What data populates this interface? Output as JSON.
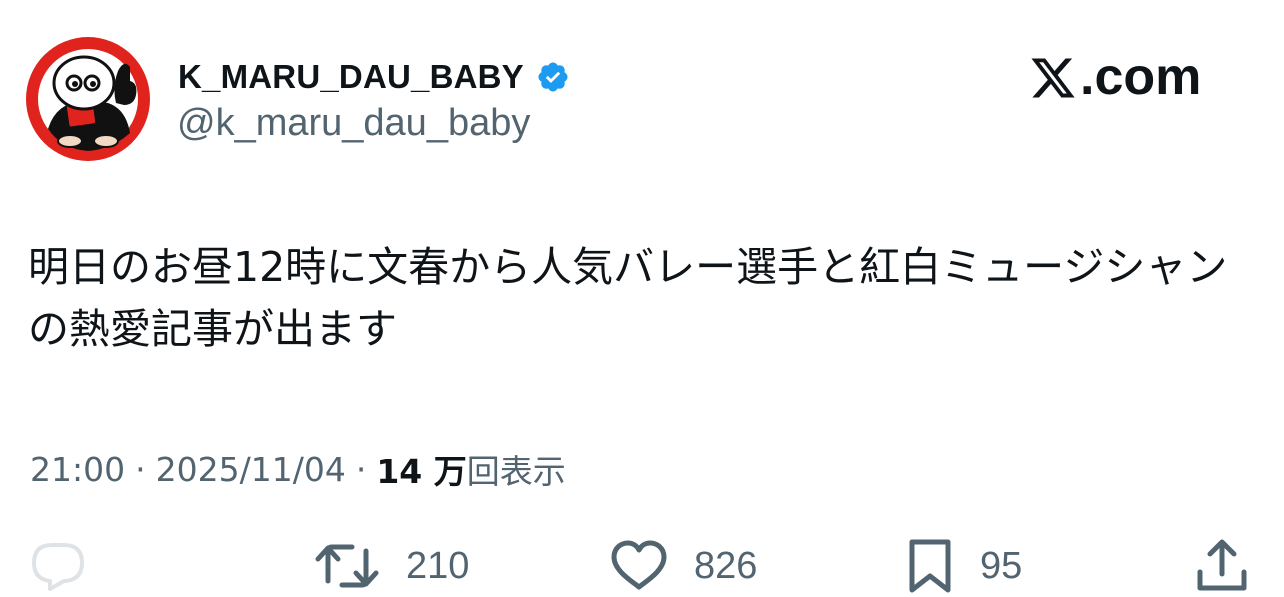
{
  "author": {
    "display_name": "K_MARU_DAU_BABY",
    "handle": "@k_maru_dau_baby",
    "verified_color": "#1d9bf0"
  },
  "brand": {
    "text": ".com",
    "icon": "x-logo-icon"
  },
  "tweet": {
    "text": "明日のお昼12時に文春から人気バレー選手と紅白ミュージシャンの熱愛記事が出ます"
  },
  "meta": {
    "time": "21:00",
    "separator": "·",
    "date": "2025/11/04",
    "views_count": "14 万",
    "views_label": "回表示"
  },
  "actions": {
    "reply": {
      "icon": "reply-icon"
    },
    "retweet": {
      "icon": "retweet-icon",
      "count": "210"
    },
    "like": {
      "icon": "heart-icon",
      "count": "826"
    },
    "bookmark": {
      "icon": "bookmark-icon",
      "count": "95"
    },
    "share": {
      "icon": "share-icon"
    }
  },
  "colors": {
    "text_primary": "#0f1419",
    "text_secondary": "#536471",
    "avatar_red": "#e0231c"
  }
}
